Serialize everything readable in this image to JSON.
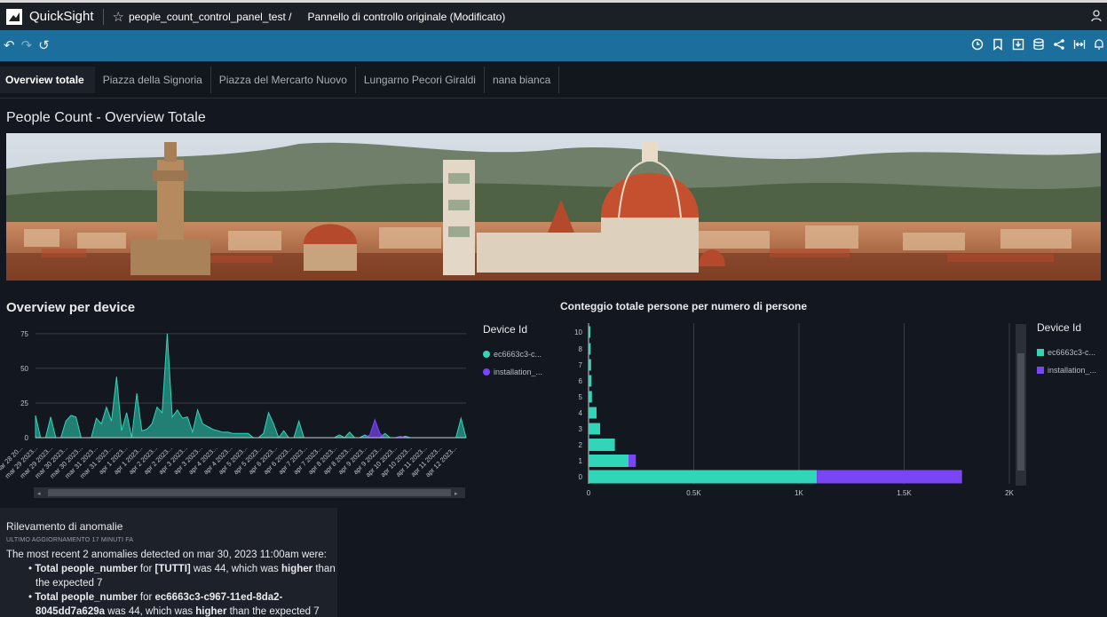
{
  "app": {
    "name": "QuickSight",
    "breadcrumb_analysis": "people_count_control_panel_test /",
    "breadcrumb_sheet": "Pannello di controllo originale (Modificato)"
  },
  "icons": {
    "logo": "quicksight-logo-icon",
    "star": "star-icon",
    "user": "user-icon",
    "undo": "undo-icon",
    "redo": "redo-icon",
    "reset": "reset-icon",
    "toolbar": [
      "clock-icon",
      "bookmark-icon",
      "download-icon",
      "dataset-icon",
      "share-icon",
      "fit-width-icon",
      "bell-icon"
    ]
  },
  "tabs": [
    {
      "label": "Overview totale",
      "active": true
    },
    {
      "label": "Piazza della Signoria"
    },
    {
      "label": "Piazza del Mercarto Nuovo"
    },
    {
      "label": "Lungarno Pecori Giraldi"
    },
    {
      "label": "nana bianca"
    }
  ],
  "page_title": "People Count - Overview Totale",
  "colors": {
    "teal": "#2fd6b8",
    "purple": "#7a45f5",
    "toolbar": "#1c6f9c"
  },
  "line_panel": {
    "title": "Overview per device",
    "legend_title": "Device Id",
    "legend": [
      "ec6663c3-c...",
      "installation_..."
    ]
  },
  "bar_panel": {
    "title": "Conteggio totale persone per numero di persone",
    "legend_title": "Device Id",
    "legend": [
      "ec6663c3-c...",
      "installation_..."
    ]
  },
  "chart_data": [
    {
      "type": "area",
      "title": "Overview per device",
      "ylim": [
        0,
        80
      ],
      "y_ticks": [
        "0",
        "25",
        "50",
        "75"
      ],
      "x_ticks": [
        "mar 28 20...",
        "mar 29 2023...",
        "mar 29 2023...",
        "mar 30 2023...",
        "mar 30 2023...",
        "mar 31 2023...",
        "mar 31 2023...",
        "apr 1 2023...",
        "apr 1 2023...",
        "apr 2 2023...",
        "apr 2 2023...",
        "apr 3 2023...",
        "apr 3 2023...",
        "apr 4 2023...",
        "apr 4 2023...",
        "apr 5 2023...",
        "apr 5 2023...",
        "apr 6 2023...",
        "apr 6 2023...",
        "apr 7 2023...",
        "apr 7 2023...",
        "apr 8 2023...",
        "apr 8 2023...",
        "apr 9 2023...",
        "apr 9 2023...",
        "apr 10 2023...",
        "apr 10 2023...",
        "apr 11 2023...",
        "apr 11 2023...",
        "apr 12 2023..."
      ],
      "series": [
        {
          "name": "ec6663c3-c...",
          "values": [
            16,
            0,
            0,
            15,
            0,
            0,
            12,
            16,
            15,
            0,
            0,
            0,
            14,
            10,
            22,
            12,
            44,
            5,
            18,
            0,
            32,
            5,
            6,
            10,
            22,
            18,
            75,
            15,
            20,
            14,
            15,
            4,
            20,
            10,
            8,
            6,
            5,
            4,
            4,
            3,
            3,
            3,
            3,
            0,
            0,
            3,
            18,
            10,
            0,
            5,
            0,
            0,
            12,
            0,
            0,
            0,
            0,
            0,
            0,
            0,
            2,
            0,
            4,
            0,
            0,
            2,
            0,
            0,
            0,
            3,
            0,
            0,
            0,
            1,
            0,
            0,
            0,
            0,
            0,
            0,
            0,
            0,
            0,
            0,
            14,
            0
          ]
        },
        {
          "name": "installation_...",
          "values": [
            0,
            0,
            0,
            0,
            0,
            0,
            0,
            0,
            0,
            0,
            0,
            0,
            0,
            0,
            0,
            0,
            0,
            0,
            0,
            0,
            0,
            0,
            0,
            0,
            0,
            0,
            0,
            0,
            0,
            0,
            0,
            0,
            0,
            0,
            0,
            0,
            0,
            0,
            0,
            0,
            0,
            0,
            0,
            0,
            0,
            0,
            0,
            0,
            0,
            0,
            0,
            0,
            0,
            0,
            0,
            0,
            0,
            0,
            0,
            0,
            0,
            0,
            0,
            0,
            0,
            0,
            2,
            13,
            3,
            0,
            0,
            0,
            1,
            0,
            0,
            0,
            0,
            0,
            0,
            0,
            0,
            0,
            0,
            0,
            0,
            0
          ]
        }
      ]
    },
    {
      "type": "bar",
      "orientation": "horizontal",
      "stacked": true,
      "title": "Conteggio totale persone per numero di persone",
      "categories": [
        "0",
        "1",
        "2",
        "3",
        "4",
        "5",
        "6",
        "7",
        "8",
        "10"
      ],
      "xlim": [
        0,
        2000
      ],
      "x_ticks": [
        "0",
        "0.5K",
        "1K",
        "1.5K",
        "2K"
      ],
      "series": [
        {
          "name": "ec6663c3-c...",
          "values": [
            1085,
            190,
            125,
            55,
            38,
            16,
            14,
            12,
            10,
            4
          ]
        },
        {
          "name": "installation_...",
          "values": [
            690,
            35,
            0,
            0,
            0,
            0,
            0,
            0,
            0,
            0
          ]
        }
      ]
    }
  ],
  "anomaly": {
    "title": "Rilevamento di anomalie",
    "subtitle": "ULTIMO AGGIORNAMENTO 17 MINUTI FA",
    "intro": "The most recent 2 anomalies detected on mar 30, 2023 11:00am were:",
    "items": [
      {
        "metric": "Total people_number",
        "for": " for ",
        "entity": "[TUTTI]",
        "mid": " was 44, which was ",
        "dir": "higher",
        "tail": " than the expected 7"
      },
      {
        "metric": "Total people_number",
        "for": " for ",
        "entity": "ec6663c3-c967-11ed-8da2-8045dd7a629a",
        "mid": " was 44, which was ",
        "dir": "higher",
        "tail": " than the expected 7"
      }
    ]
  }
}
